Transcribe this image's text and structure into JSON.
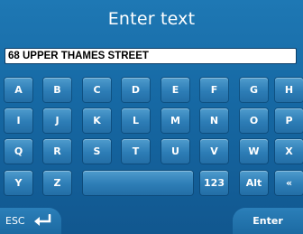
{
  "title": "Enter text",
  "text_field": {
    "value": "68 UPPER THAMES STREET"
  },
  "keys": {
    "row1": [
      "A",
      "B",
      "C",
      "D",
      "E",
      "F",
      "G",
      "H"
    ],
    "row2": [
      "I",
      "J",
      "K",
      "L",
      "M",
      "N",
      "O",
      "P"
    ],
    "row3": [
      "Q",
      "R",
      "S",
      "T",
      "U",
      "V",
      "W",
      "X"
    ],
    "row4": {
      "y": "Y",
      "z": "Z",
      "space": "",
      "num": "123",
      "alt": "Alt",
      "back": "«"
    }
  },
  "footer": {
    "esc_label": "ESC",
    "esc_icon": "return-arrow-icon",
    "enter_label": "Enter"
  },
  "colors": {
    "background": "#1a6fa8",
    "key": "#2d7db6",
    "field": "#ffffff"
  }
}
